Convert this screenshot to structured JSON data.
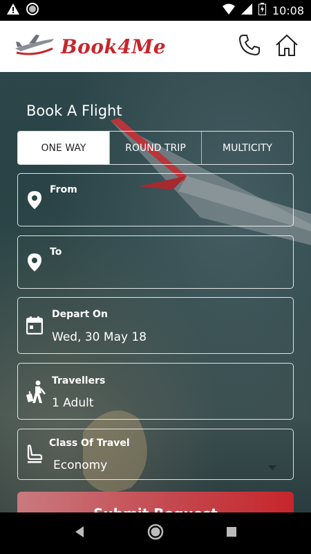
{
  "status_bar": {
    "time": "10:08",
    "icons": [
      "warning-icon",
      "circle-icon",
      "wifi-icon",
      "signal-icon",
      "battery-icon"
    ]
  },
  "header": {
    "logo_text": "Book4Me",
    "brand_color": "#c6262c",
    "actions": [
      "phone-icon",
      "home-icon"
    ]
  },
  "booking": {
    "title": "Book A Flight",
    "tabs": [
      {
        "label": "ONE WAY",
        "active": true
      },
      {
        "label": "ROUND TRIP",
        "active": false
      },
      {
        "label": "MULTICITY",
        "active": false
      }
    ],
    "from": {
      "label": "From",
      "value": ""
    },
    "to": {
      "label": "To",
      "value": ""
    },
    "depart": {
      "label": "Depart On",
      "value": "Wed, 30 May 18"
    },
    "travellers": {
      "label": "Travellers",
      "value": "1 Adult"
    },
    "class_of_travel": {
      "label": "Class Of Travel",
      "value": "Economy"
    },
    "submit_label": "Submit Request"
  }
}
